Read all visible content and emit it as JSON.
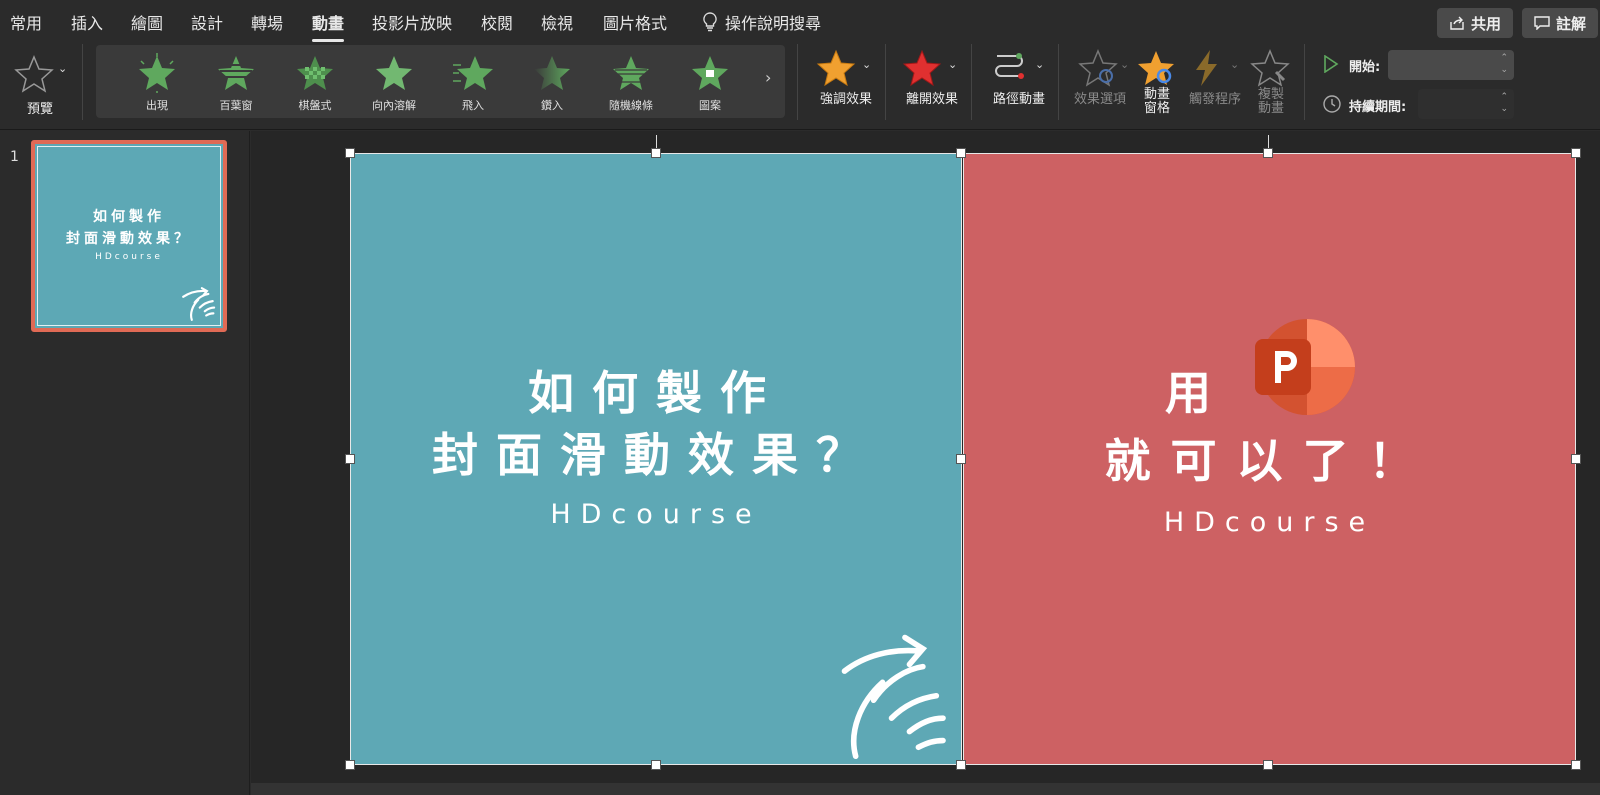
{
  "tabs": [
    {
      "label": "常用",
      "active": false
    },
    {
      "label": "插入",
      "active": false
    },
    {
      "label": "繪圖",
      "active": false
    },
    {
      "label": "設計",
      "active": false
    },
    {
      "label": "轉場",
      "active": false
    },
    {
      "label": "動畫",
      "active": true
    },
    {
      "label": "投影片放映",
      "active": false
    },
    {
      "label": "校閱",
      "active": false
    },
    {
      "label": "檢視",
      "active": false
    },
    {
      "label": "圖片格式",
      "active": false
    }
  ],
  "tell_me": "操作說明搜尋",
  "share_label": "共用",
  "comment_label": "註解",
  "ribbon": {
    "preview_label": "預覽",
    "gallery": [
      "出現",
      "百葉窗",
      "棋盤式",
      "向內溶解",
      "飛入",
      "鑽入",
      "隨機線條",
      "圖案"
    ],
    "emphasis_label": "強調效果",
    "exit_label": "離開效果",
    "path_label": "路徑動畫",
    "effect_options_label": "效果選項",
    "anim_pane_label_1": "動畫",
    "anim_pane_label_2": "窗格",
    "trigger_label": "觸發程序",
    "copy_anim_label_1": "複製",
    "copy_anim_label_2": "動畫",
    "start_label": "開始:",
    "duration_label": "持續期間:"
  },
  "slide_pane": {
    "slide_number": "1",
    "thumb_line1": "如何製作",
    "thumb_line2": "封面滑動效果？",
    "thumb_brand": "HDcourse"
  },
  "slide": {
    "left_line1": "如何製作",
    "left_line2": "封面滑動效果？",
    "left_brand": "HDcourse",
    "right_line1": "用",
    "right_line2": "就可以了！",
    "right_brand": "HDcourse",
    "left_color": "#5ea8b5",
    "right_color": "#cd6163"
  }
}
